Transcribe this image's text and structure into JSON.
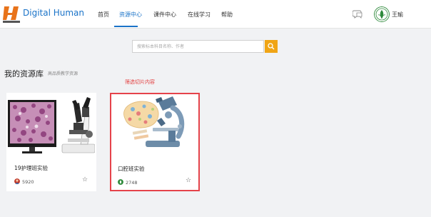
{
  "header": {
    "brand": "Digital Human",
    "nav": [
      "首页",
      "资源中心",
      "课件中心",
      "在线学习",
      "帮助"
    ],
    "active_index": 1,
    "username": "王瑜",
    "icons": [
      "logo-icon",
      "chat-icon",
      "avatar"
    ]
  },
  "search": {
    "placeholder": "搜索标本科目名称、作者",
    "button_icon": "search-icon"
  },
  "library": {
    "title": "我的资源库",
    "subtitle": "高品质教学资源",
    "hint": "筛选切片内容"
  },
  "cards": [
    {
      "title": "19护理班实验",
      "count": "5920",
      "selected": false,
      "image": "microscope-with-monitor"
    },
    {
      "title": "口腔班实验",
      "count": "2748",
      "selected": true,
      "image": "microscope-illustration"
    }
  ],
  "colors": {
    "accent": "#1a73c8",
    "search_button": "#f0a516",
    "highlight": "#e5434a"
  }
}
